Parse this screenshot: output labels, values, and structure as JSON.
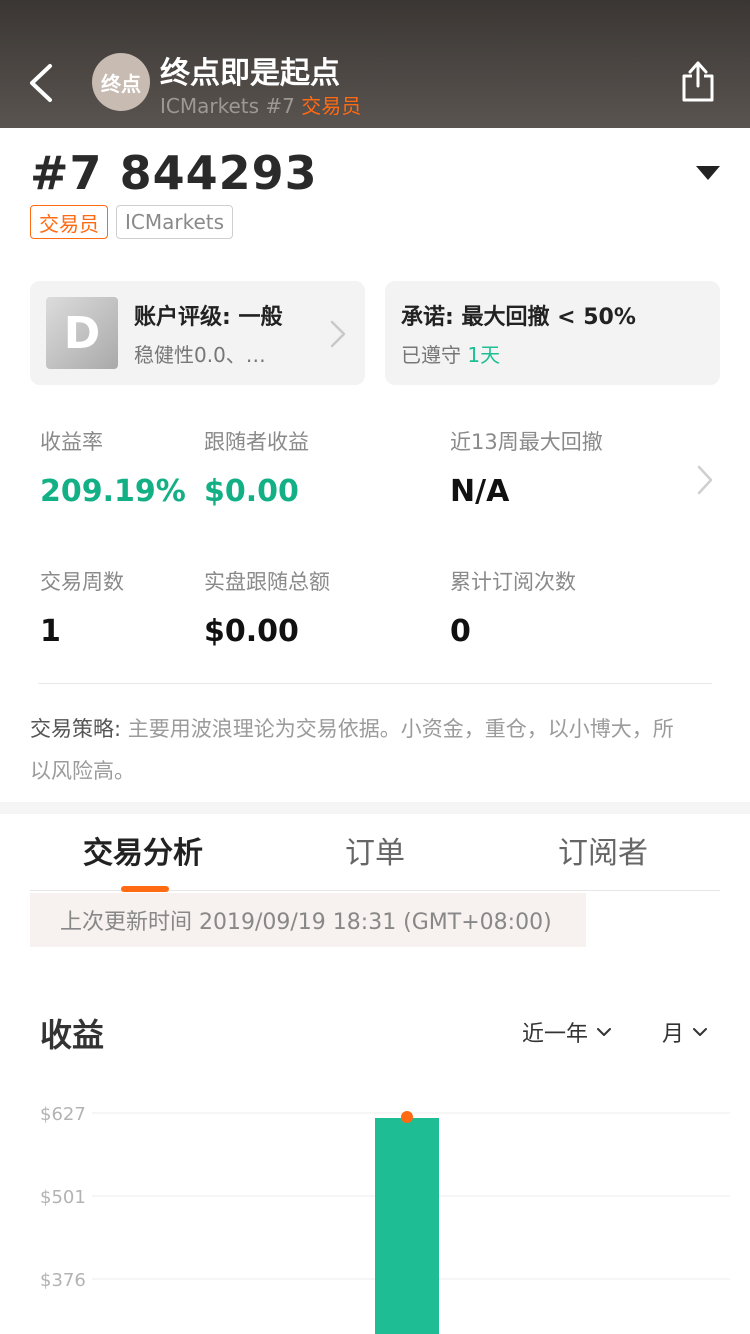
{
  "header": {
    "avatar_text": "终点",
    "title": "终点即是起点",
    "sub_broker": "ICMarkets #7",
    "sub_role": "交易员"
  },
  "account": {
    "id": "#7 844293",
    "tag_role": "交易员",
    "tag_broker": "ICMarkets"
  },
  "rating_card": {
    "grade": "D",
    "title": "账户评级: 一般",
    "sub": "稳健性0.0、…"
  },
  "promise_card": {
    "title": "承诺: 最大回撤 < 50%",
    "sub_prefix": "已遵守 ",
    "sub_days": "1天"
  },
  "stats": {
    "row1": [
      {
        "label": "收益率",
        "value": "209.19%"
      },
      {
        "label": "跟随者收益",
        "value": "$0.00"
      },
      {
        "label": "近13周最大回撤",
        "value": "N/A"
      }
    ],
    "row2": [
      {
        "label": "交易周数",
        "value": "1"
      },
      {
        "label": "实盘跟随总额",
        "value": "$0.00"
      },
      {
        "label": "累计订阅次数",
        "value": "0"
      }
    ]
  },
  "strategy": {
    "label": "交易策略: ",
    "text": "主要用波浪理论为交易依据。小资金，重仓，以小博大，所以风险高。"
  },
  "tabs": [
    {
      "label": "交易分析"
    },
    {
      "label": "订单"
    },
    {
      "label": "订阅者"
    }
  ],
  "update_text": "上次更新时间 2019/09/19 18:31 (GMT+08:00)",
  "chart_header": {
    "title": "收益",
    "range_filter": "近一年",
    "period_filter": "月"
  },
  "colors": {
    "accent": "#ff6a13",
    "positive": "#13b085",
    "bar": "#1ebd94"
  },
  "chart_data": {
    "type": "bar",
    "title": "收益",
    "y_ticks": [
      "$627",
      "$501",
      "$376"
    ],
    "ylim": [
      376,
      627
    ],
    "categories": [
      ""
    ],
    "values": [
      627
    ],
    "grid": true
  }
}
